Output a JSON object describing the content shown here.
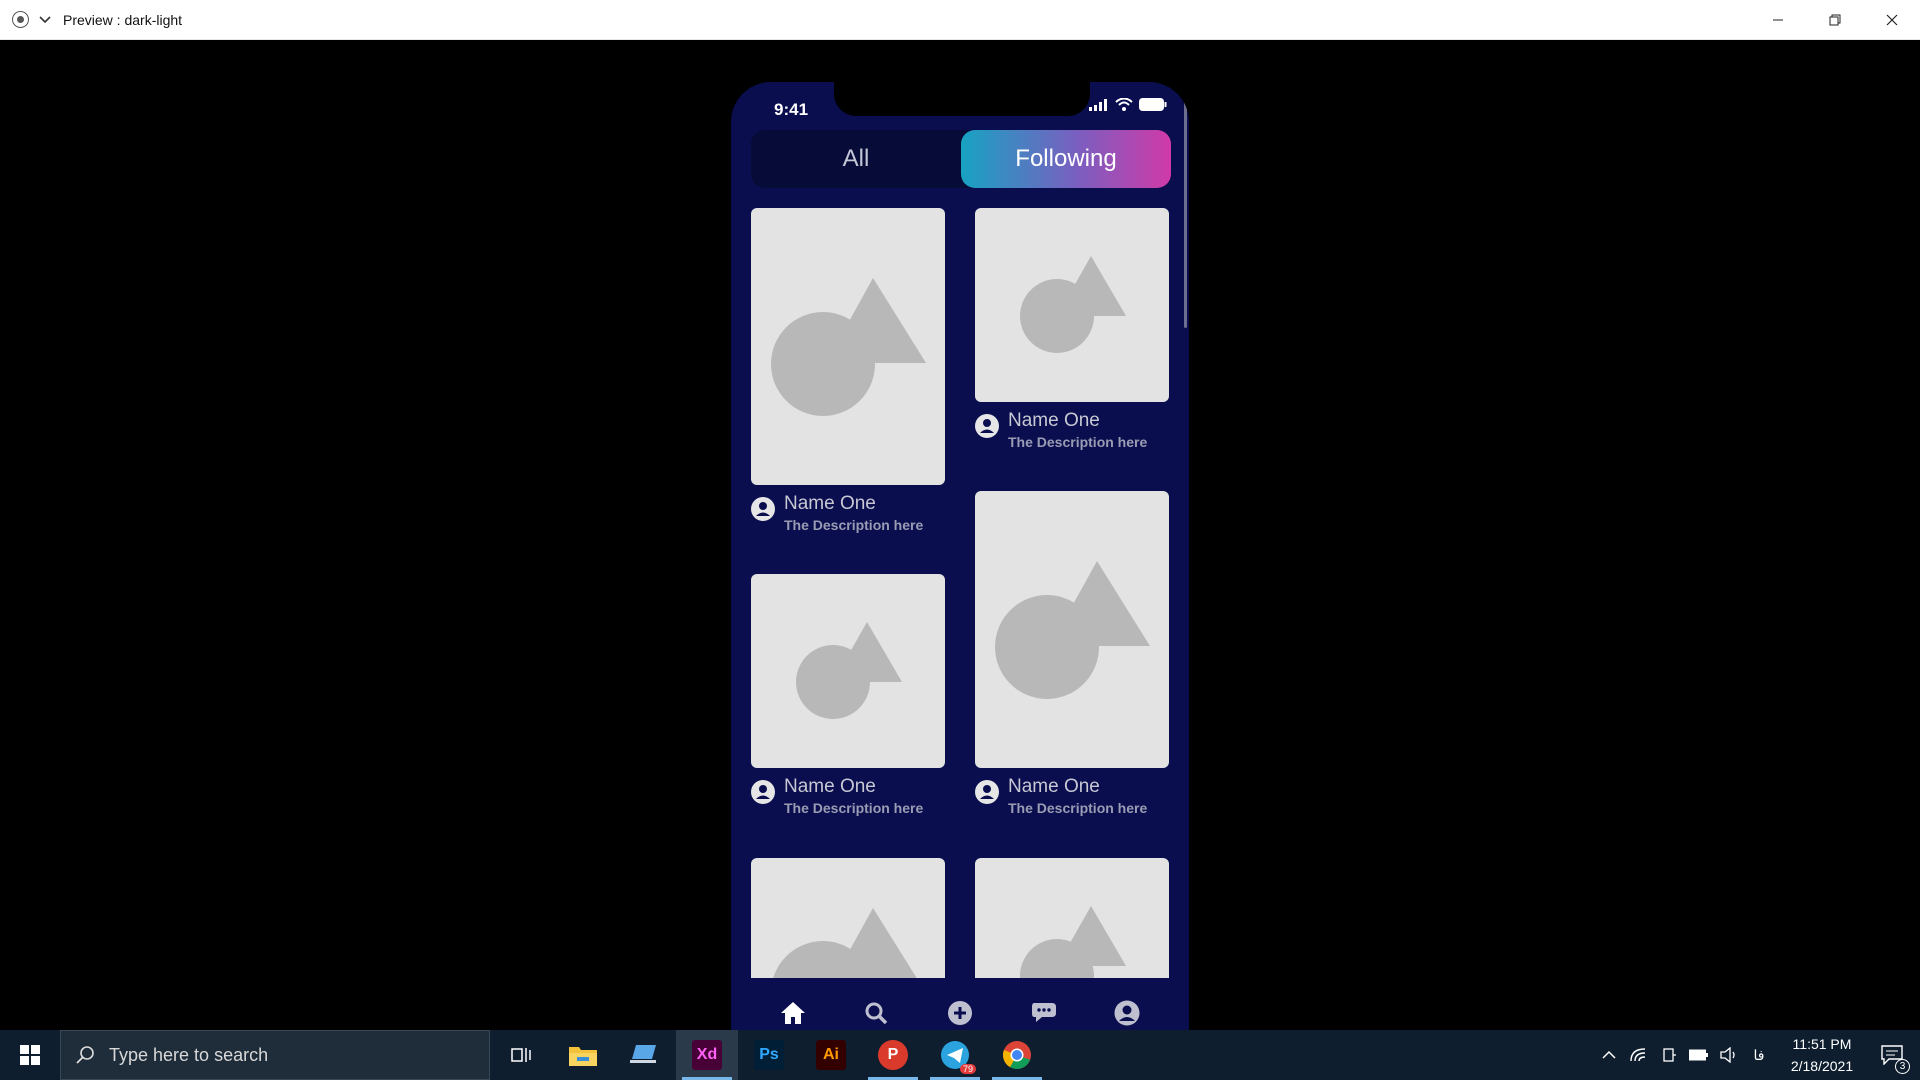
{
  "window": {
    "title": "Preview : dark-light"
  },
  "phone": {
    "status_time": "9:41",
    "tabs": [
      {
        "label": "All",
        "selected": false
      },
      {
        "label": "Following",
        "selected": true
      }
    ],
    "cards": [
      {
        "name": "Name One",
        "description": "The Description here"
      },
      {
        "name": "Name One",
        "description": "The Description here"
      },
      {
        "name": "Name One",
        "description": "The Description here"
      },
      {
        "name": "Name One",
        "description": "The Description here"
      },
      {
        "name": "",
        "description": ""
      },
      {
        "name": "",
        "description": ""
      }
    ],
    "nav_icons": [
      "home-icon",
      "search-icon",
      "add-circle-icon",
      "chat-icon",
      "profile-icon"
    ],
    "colors": {
      "background": "#0a0e4f",
      "segment_gradient_start": "#17a3c2",
      "segment_gradient_end": "#d03aa8",
      "placeholder": "#e3e3e3"
    }
  },
  "taskbar": {
    "search_placeholder": "Type here to search",
    "apps": [
      {
        "name": "Task View",
        "icon": "task-view-icon"
      },
      {
        "name": "File Explorer",
        "icon": "folder-icon"
      },
      {
        "name": "Remote app",
        "icon": "laptop-icon"
      },
      {
        "name": "Xd",
        "label": "Xd",
        "active": true
      },
      {
        "name": "Ps",
        "label": "Ps"
      },
      {
        "name": "Ai",
        "label": "Ai"
      },
      {
        "name": "P",
        "label": "P"
      },
      {
        "name": "Telegram",
        "badge": "79"
      },
      {
        "name": "Chrome",
        "icon": "chrome-icon"
      }
    ],
    "tray_lang": "فا",
    "time": "11:51 PM",
    "date": "2/18/2021",
    "notifications": "3"
  }
}
